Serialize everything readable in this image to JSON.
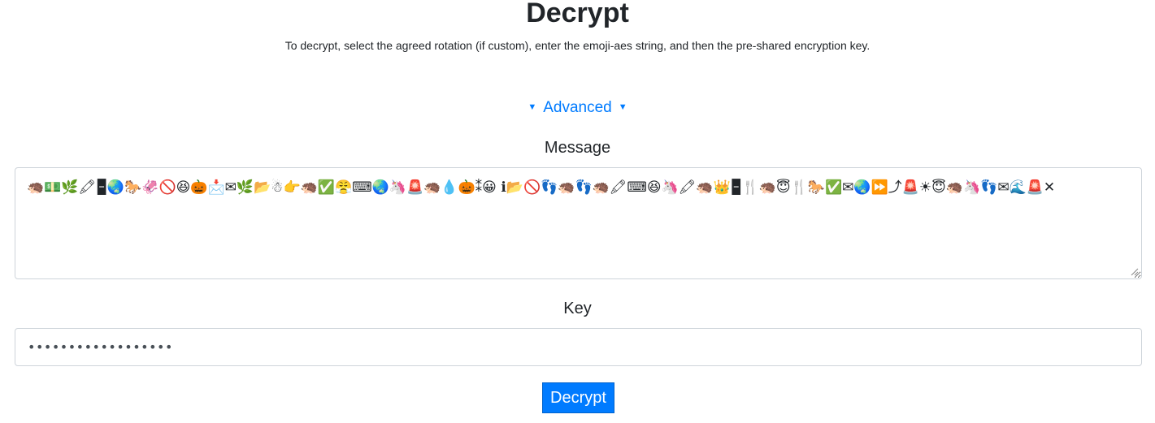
{
  "header": {
    "title": "Decrypt",
    "subtitle": "To decrypt, select the agreed rotation (if custom), enter the emoji-aes string, and then the pre-shared encryption key."
  },
  "advanced": {
    "label": "Advanced",
    "left_indicator": "▼",
    "right_indicator": "▼"
  },
  "message": {
    "label": "Message",
    "value": "🦔💵🌿🖍🁢🌏🐎🦑🚫😆🎃📩✉🌿📂☃👉🦔✅😤⌨🌏🦄🚨🦔💧🎃⁑😀 ℹ📂🚫👣🦔👣🦔🖍⌨😆🦄🖍🦔👑🁢🍴🦔😇🍴🐎✅✉🌏⏩⤴🚨☀😇🦔🦄👣✉🌊🚨✕"
  },
  "key": {
    "label": "Key",
    "masked_value": "••••••••••••••••••"
  },
  "actions": {
    "decrypt_label": "Decrypt"
  },
  "colors": {
    "accent": "#007bff",
    "text": "#212529",
    "border": "#ced4da"
  }
}
